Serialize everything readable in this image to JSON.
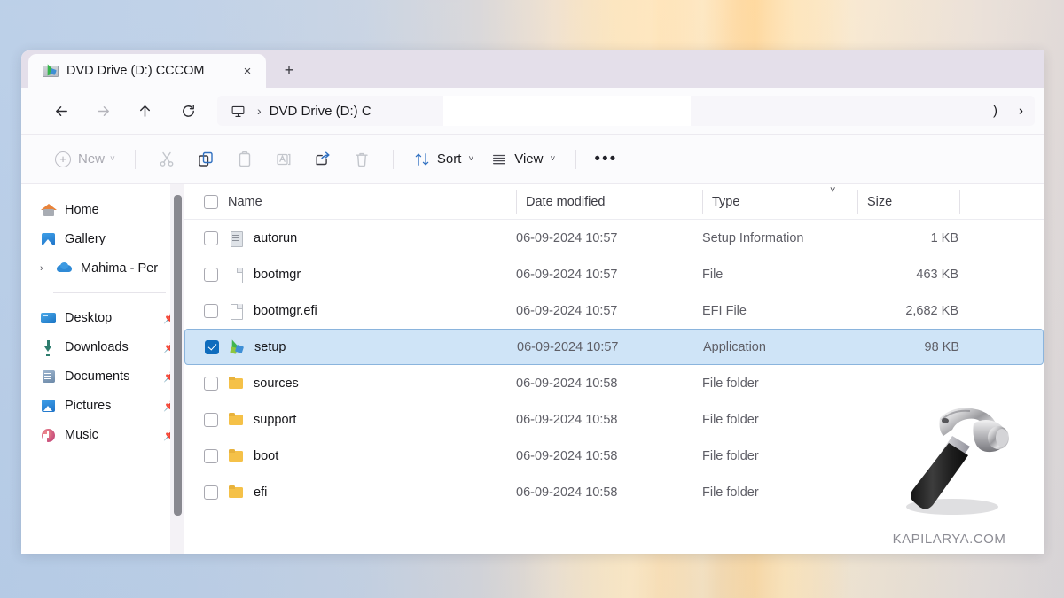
{
  "window": {
    "tab": {
      "title": "DVD Drive (D:) CCCOM",
      "icon": "dvd-drive-icon",
      "close_label": "×"
    },
    "new_tab_label": "+"
  },
  "nav": {
    "back": "←",
    "forward": "→",
    "up": "↑",
    "refresh": "↻",
    "breadcrumb": {
      "root_icon": "this-pc-icon",
      "separator": "›",
      "text": "DVD Drive (D:) C",
      "tail": ")",
      "end_separator": "›"
    }
  },
  "toolbar": {
    "new_label": "New",
    "new_plus": "+",
    "chevron": "˅",
    "cut_label": "Cut",
    "copy_label": "Copy",
    "paste_label": "Paste",
    "rename_label": "Rename",
    "share_label": "Share",
    "delete_label": "Delete",
    "sort_label": "Sort",
    "view_label": "View",
    "more_label": "•••"
  },
  "sidebar": {
    "items": [
      {
        "label": "Home",
        "icon": "home-icon",
        "pinned": false,
        "expander": false
      },
      {
        "label": "Gallery",
        "icon": "gallery-icon",
        "pinned": false,
        "expander": false
      },
      {
        "label": "Mahima - Per",
        "icon": "onedrive-cloud-icon",
        "pinned": false,
        "expander": true
      }
    ],
    "pinned_items": [
      {
        "label": "Desktop",
        "icon": "desktop-icon",
        "pin": "✒"
      },
      {
        "label": "Downloads",
        "icon": "downloads-icon",
        "pin": "✒"
      },
      {
        "label": "Documents",
        "icon": "documents-icon",
        "pin": "✒"
      },
      {
        "label": "Pictures",
        "icon": "pictures-icon",
        "pin": "✒"
      },
      {
        "label": "Music",
        "icon": "music-icon",
        "pin": "✒"
      }
    ]
  },
  "filelist": {
    "columns": {
      "name": "Name",
      "date_modified": "Date modified",
      "type": "Type",
      "size": "Size"
    },
    "sort_indicator": "˅",
    "rows": [
      {
        "name": "autorun",
        "icon": "setup-information-file-icon",
        "date": "06-09-2024 10:57",
        "type": "Setup Information",
        "size": "1 KB",
        "selected": false
      },
      {
        "name": "bootmgr",
        "icon": "generic-file-icon",
        "date": "06-09-2024 10:57",
        "type": "File",
        "size": "463 KB",
        "selected": false
      },
      {
        "name": "bootmgr.efi",
        "icon": "generic-file-icon",
        "date": "06-09-2024 10:57",
        "type": "EFI File",
        "size": "2,682 KB",
        "selected": false
      },
      {
        "name": "setup",
        "icon": "application-icon",
        "date": "06-09-2024 10:57",
        "type": "Application",
        "size": "98 KB",
        "selected": true
      },
      {
        "name": "sources",
        "icon": "folder-icon",
        "date": "06-09-2024 10:58",
        "type": "File folder",
        "size": "",
        "selected": false
      },
      {
        "name": "support",
        "icon": "folder-icon",
        "date": "06-09-2024 10:58",
        "type": "File folder",
        "size": "",
        "selected": false
      },
      {
        "name": "boot",
        "icon": "folder-icon",
        "date": "06-09-2024 10:58",
        "type": "File folder",
        "size": "",
        "selected": false
      },
      {
        "name": "efi",
        "icon": "folder-icon",
        "date": "06-09-2024 10:58",
        "type": "File folder",
        "size": "",
        "selected": false
      }
    ]
  },
  "watermark": {
    "text": "KAPILARYA.COM",
    "image": "hammer-icon"
  },
  "colors": {
    "accent": "#0f6cbd",
    "tabstrip": "#e4dfea",
    "selection_bg": "#cfe4f7",
    "selection_border": "#8ab4dd",
    "folder": "#f5c148"
  }
}
